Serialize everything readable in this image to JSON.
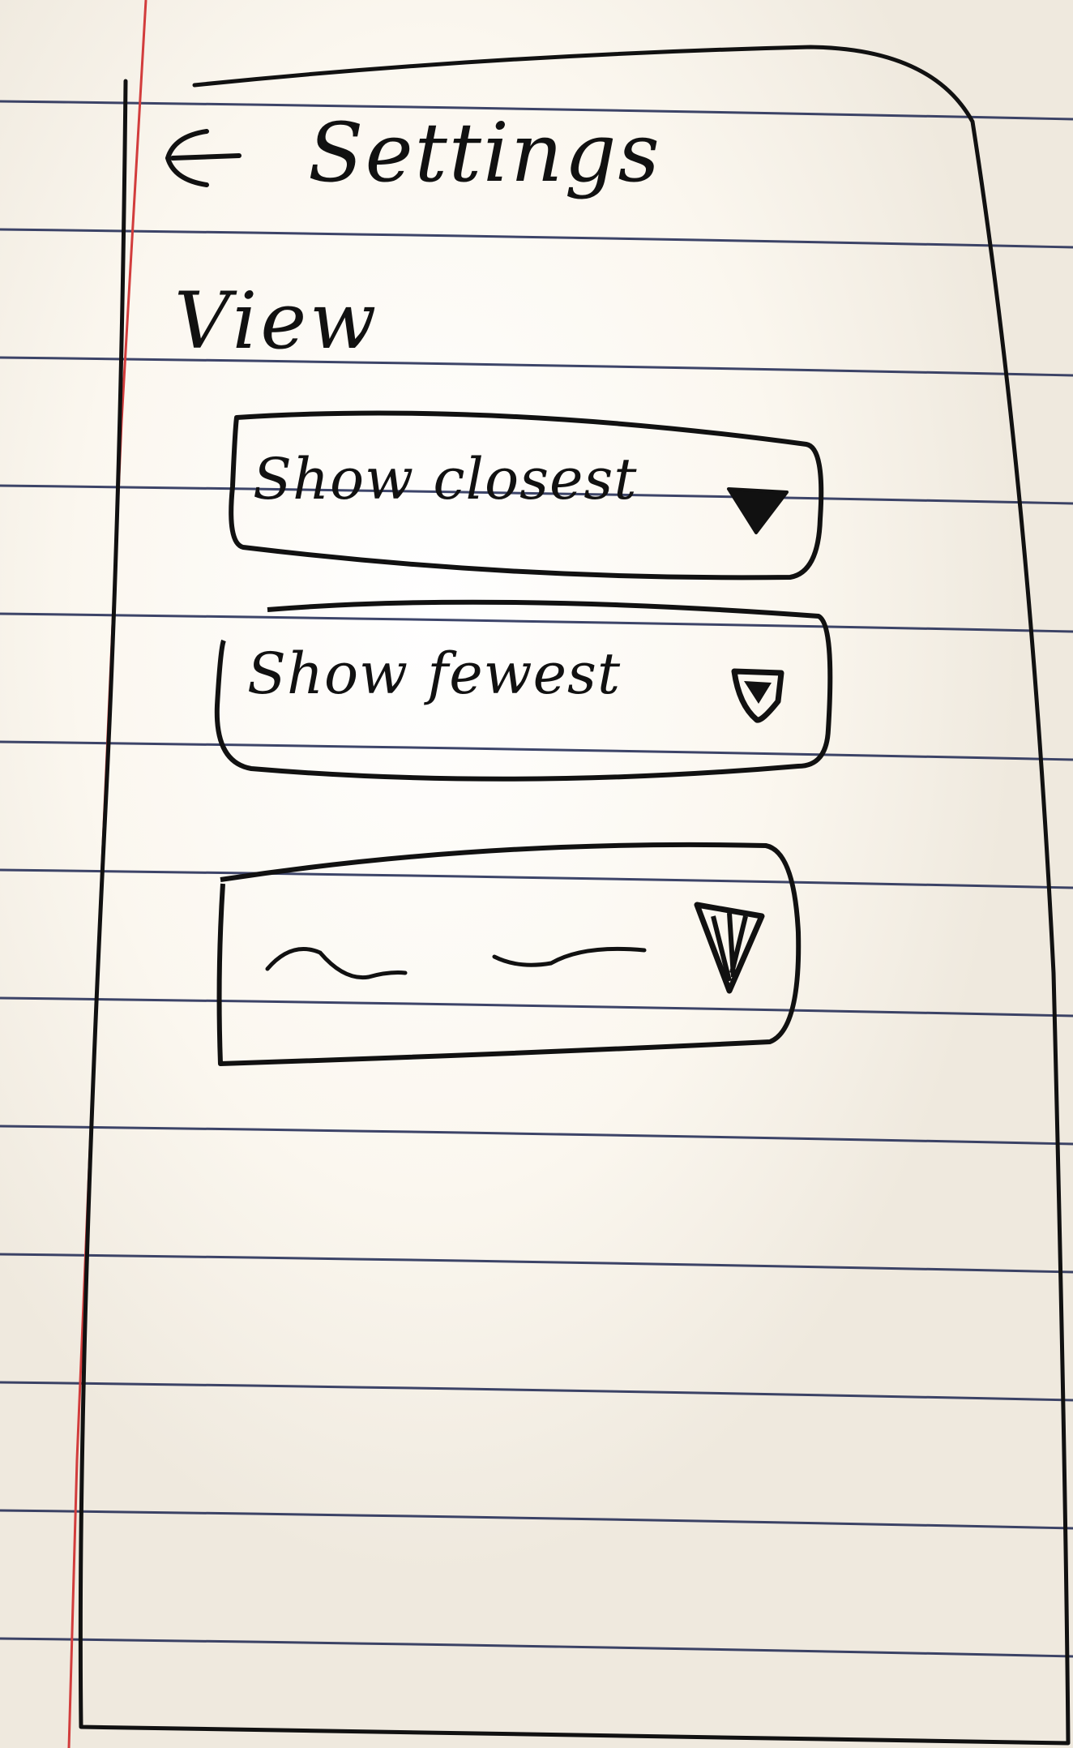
{
  "header": {
    "back_icon": "back-arrow-icon",
    "title": "Settings"
  },
  "section": {
    "title": "View"
  },
  "dropdowns": [
    {
      "value": "Show closest",
      "icon": "dropdown-triangle-icon"
    },
    {
      "value": "Show fewest",
      "icon": "dropdown-triangle-icon"
    },
    {
      "value": "",
      "icon": "dropdown-triangle-icon"
    }
  ],
  "colors": {
    "paper": "#f5f1ea",
    "ruled_line": "#1b2550",
    "margin_line": "#d23c3c",
    "ink": "#111111"
  }
}
